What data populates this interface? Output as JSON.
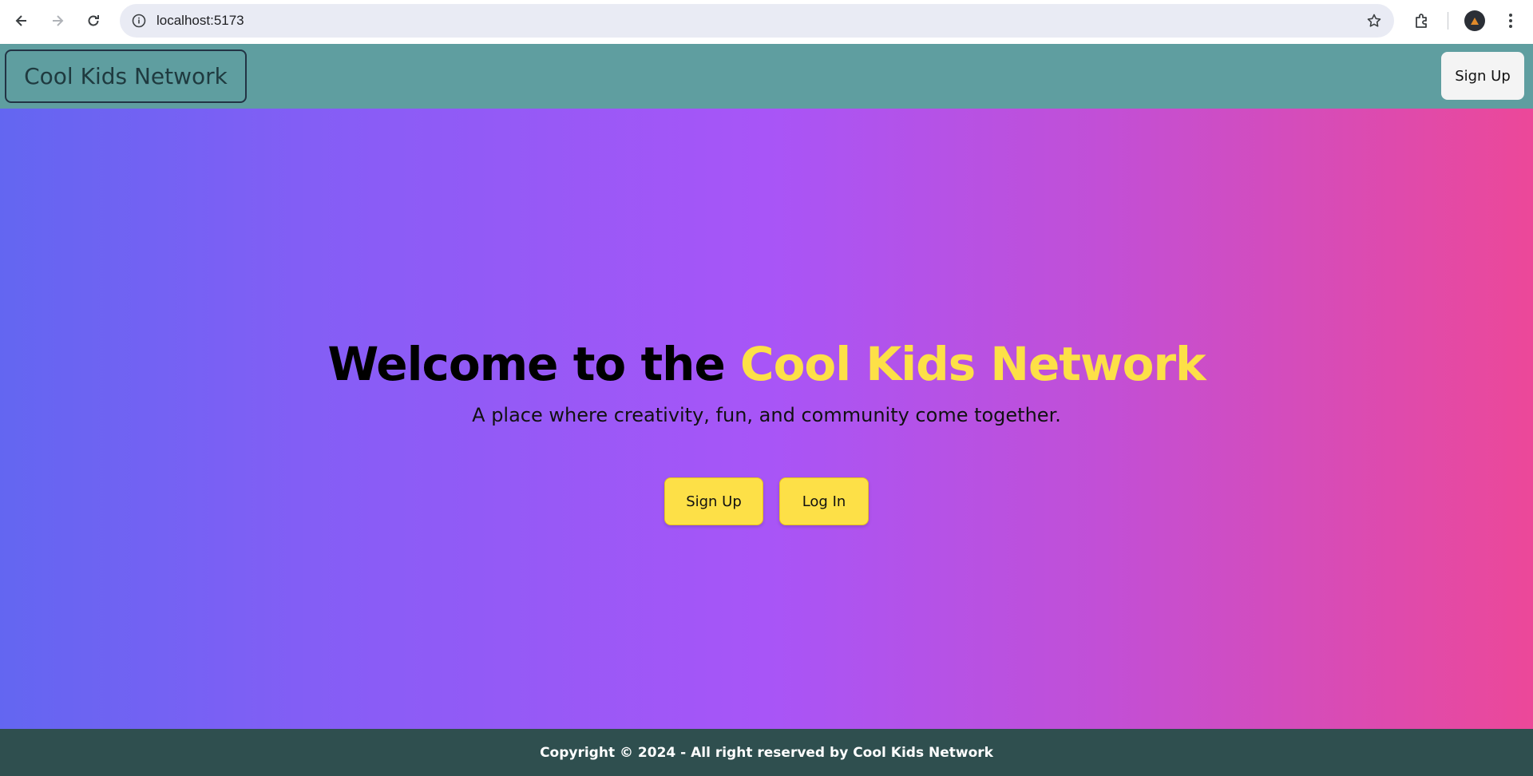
{
  "browser": {
    "url": "localhost:5173",
    "back_icon": "back-arrow-icon",
    "forward_icon": "forward-arrow-icon",
    "reload_icon": "reload-icon",
    "info_icon": "info-icon",
    "bookmark_icon": "star-icon",
    "extensions_icon": "puzzle-icon",
    "menu_icon": "kebab-menu-icon"
  },
  "header": {
    "brand": "Cool Kids Network",
    "signup_label": "Sign Up",
    "background": "#5f9ea0"
  },
  "hero": {
    "title_prefix": "Welcome to the ",
    "title_accent": "Cool Kids Network",
    "subtitle": "A place where creativity, fun, and community come together.",
    "signup_label": "Sign Up",
    "login_label": "Log In",
    "accent_color": "#fde047",
    "gradient_start": "#6366f1",
    "gradient_end": "#ec4899"
  },
  "footer": {
    "text": "Copyright © 2024 - All right reserved by Cool Kids Network",
    "background": "#2f4f4f"
  }
}
